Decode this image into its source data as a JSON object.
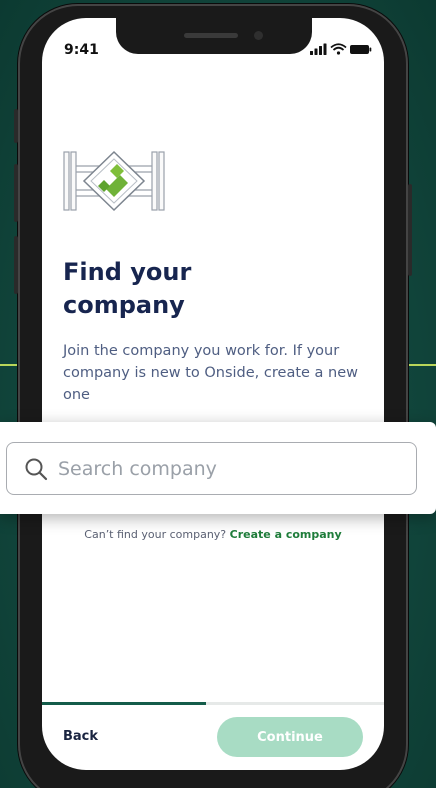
{
  "status_bar": {
    "time": "9:41"
  },
  "onboarding": {
    "title_line1": "Find your",
    "title_line2": "company",
    "description": "Join the company you work for. If your company is new to Onside, create a new one",
    "progress": 0.48
  },
  "search": {
    "placeholder": "Search company"
  },
  "footer_hint": {
    "text": "Can’t find your company?",
    "link_label": "Create a company"
  },
  "actions": {
    "back_label": "Back",
    "continue_label": "Continue"
  },
  "colors": {
    "brand_green": "#145c4a",
    "accent_lime": "#b9d65a",
    "link_green": "#1e7c3a",
    "title_navy": "#17254f",
    "continue_disabled": "#a8dcc4"
  }
}
